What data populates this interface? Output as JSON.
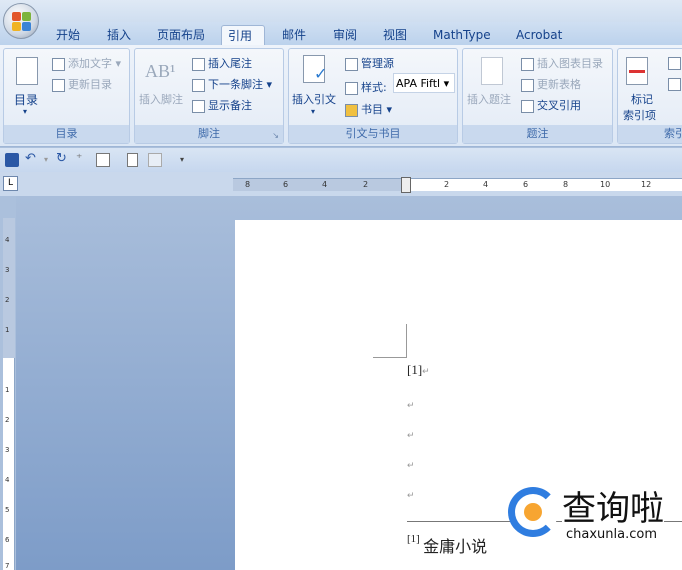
{
  "tabs": [
    "开始",
    "插入",
    "页面布局",
    "引用",
    "邮件",
    "审阅",
    "视图",
    "MathType",
    "Acrobat"
  ],
  "active_tab": "引用",
  "groups": {
    "toc": {
      "label": "目录",
      "big_button": "目录",
      "add_text": "添加文字",
      "update_toc": "更新目录"
    },
    "footnotes": {
      "label": "脚注",
      "insert_footnote": "插入脚注",
      "insert_endnote": "插入尾注",
      "next_footnote": "下一条脚注",
      "show_notes": "显示备注"
    },
    "citations": {
      "label": "引文与书目",
      "insert_citation": "插入引文",
      "manage_sources": "管理源",
      "style_label": "样式:",
      "style_value": "APA Fiftl",
      "bibliography": "书目"
    },
    "captions": {
      "label": "题注",
      "insert_caption": "插入题注",
      "insert_table_of_figures": "插入图表目录",
      "update_table": "更新表格",
      "cross_reference": "交叉引用"
    },
    "index": {
      "label": "索引",
      "mark_entry_line1": "标记",
      "mark_entry_line2": "索引项"
    }
  },
  "ruler": {
    "h_ticks": [
      "8",
      "6",
      "4",
      "2",
      "2",
      "4",
      "6",
      "8",
      "10",
      "12"
    ],
    "v_ticks": [
      "4",
      "3",
      "2",
      "1",
      "1",
      "2",
      "3",
      "4",
      "5",
      "6",
      "7"
    ],
    "corner": "L"
  },
  "document": {
    "ref_marker": "[1]",
    "footnote_marker": "[1]",
    "footnote_text": "金庸小说",
    "para_mark": "↵"
  },
  "watermark": {
    "text": "查询啦",
    "domain": "chaxunla.com"
  }
}
